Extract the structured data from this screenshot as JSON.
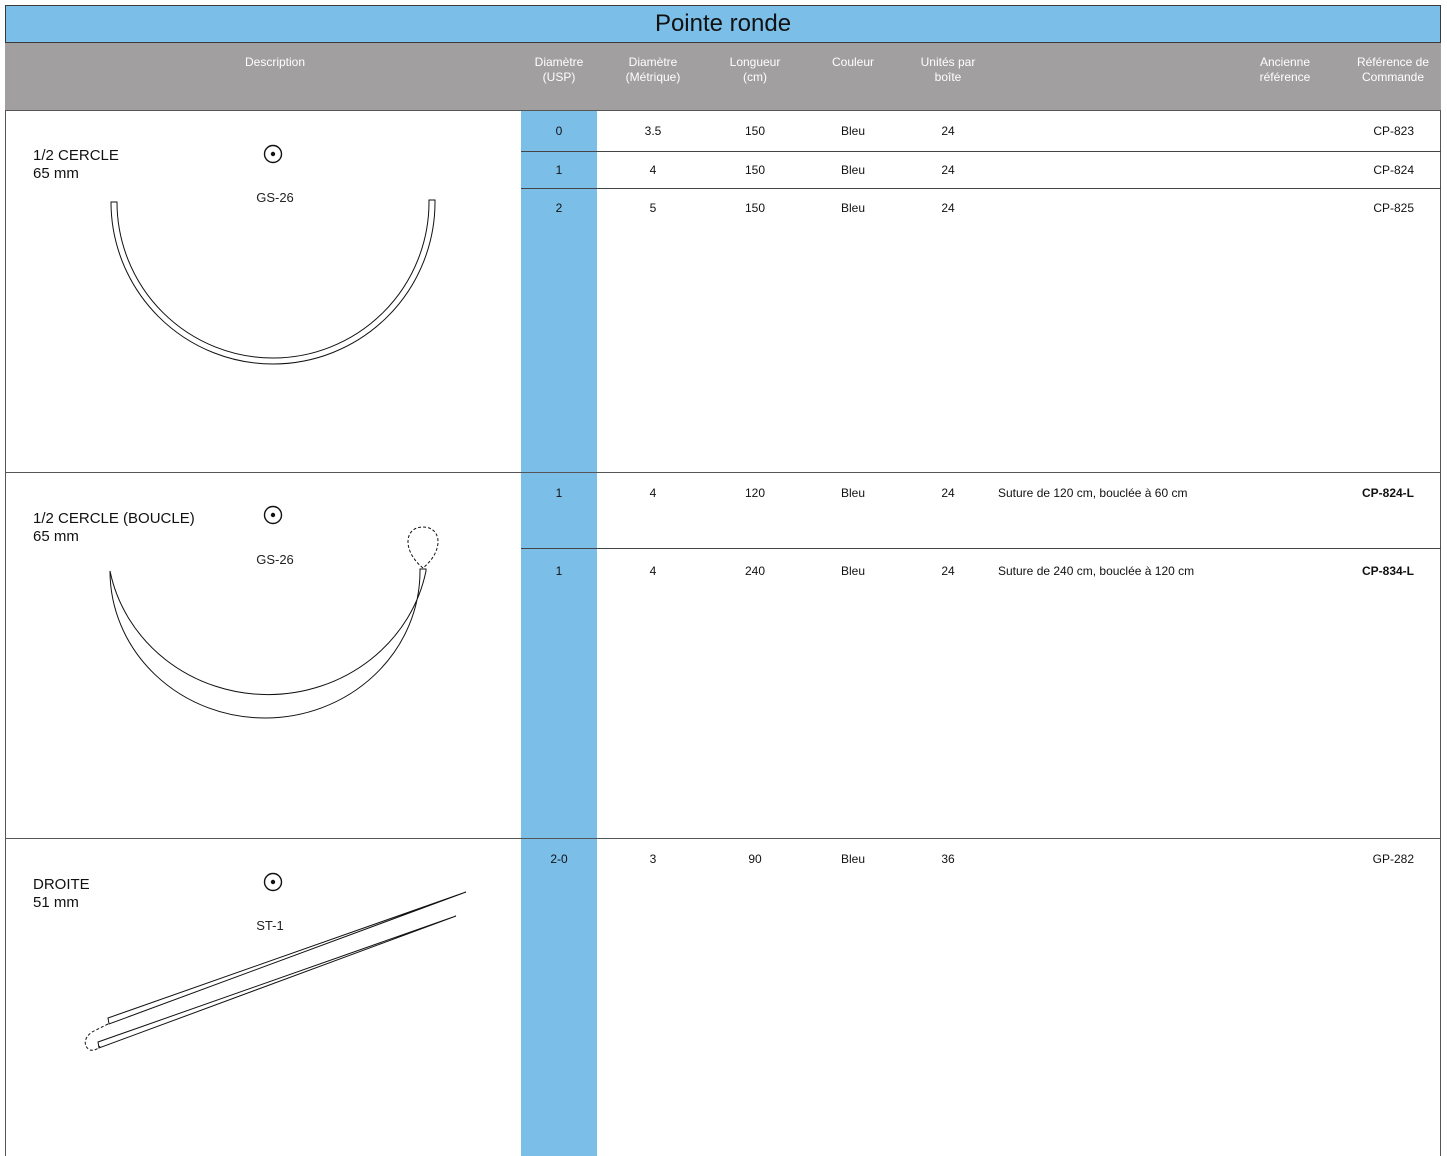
{
  "title": "Pointe ronde",
  "header": {
    "description": "Description",
    "diam_usp": "Diamètre\n(USP)",
    "diam_metric": "Diamètre\n(Métrique)",
    "length": "Longueur\n(cm)",
    "color": "Couleur",
    "units": "Unités par\nboîte",
    "old_ref": "Ancienne\nréférence",
    "order_ref": "Référence de\nCommande"
  },
  "colors": {
    "accent_blue": "#7bbfe8",
    "header_gray": "#a19fa0"
  },
  "sections": [
    {
      "name": "1/2 CERCLE",
      "size": "65 mm",
      "code": "GS-26",
      "icon": "round-point-icon",
      "rows": [
        {
          "usp": "0",
          "metric": "3.5",
          "length": "150",
          "color": "Bleu",
          "units": "24",
          "note": "",
          "ref": "CP-823"
        },
        {
          "usp": "1",
          "metric": "4",
          "length": "150",
          "color": "Bleu",
          "units": "24",
          "note": "",
          "ref": "CP-824"
        },
        {
          "usp": "2",
          "metric": "5",
          "length": "150",
          "color": "Bleu",
          "units": "24",
          "note": "",
          "ref": "CP-825"
        }
      ]
    },
    {
      "name": "1/2 CERCLE (BOUCLE)",
      "size": "65 mm",
      "code": "GS-26",
      "icon": "round-point-icon",
      "rows": [
        {
          "usp": "1",
          "metric": "4",
          "length": "120",
          "color": "Bleu",
          "units": "24",
          "note": "Suture de 120 cm, bouclée à 60 cm",
          "ref": "CP-824-L"
        },
        {
          "usp": "1",
          "metric": "4",
          "length": "240",
          "color": "Bleu",
          "units": "24",
          "note": "Suture de 240 cm, bouclée à 120 cm",
          "ref": "CP-834-L"
        }
      ]
    },
    {
      "name": "DROITE",
      "size": "51 mm",
      "code": "ST-1",
      "icon": "round-point-icon",
      "rows": [
        {
          "usp": "2-0",
          "metric": "3",
          "length": "90",
          "color": "Bleu",
          "units": "36",
          "note": "",
          "ref": "GP-282"
        }
      ]
    }
  ]
}
